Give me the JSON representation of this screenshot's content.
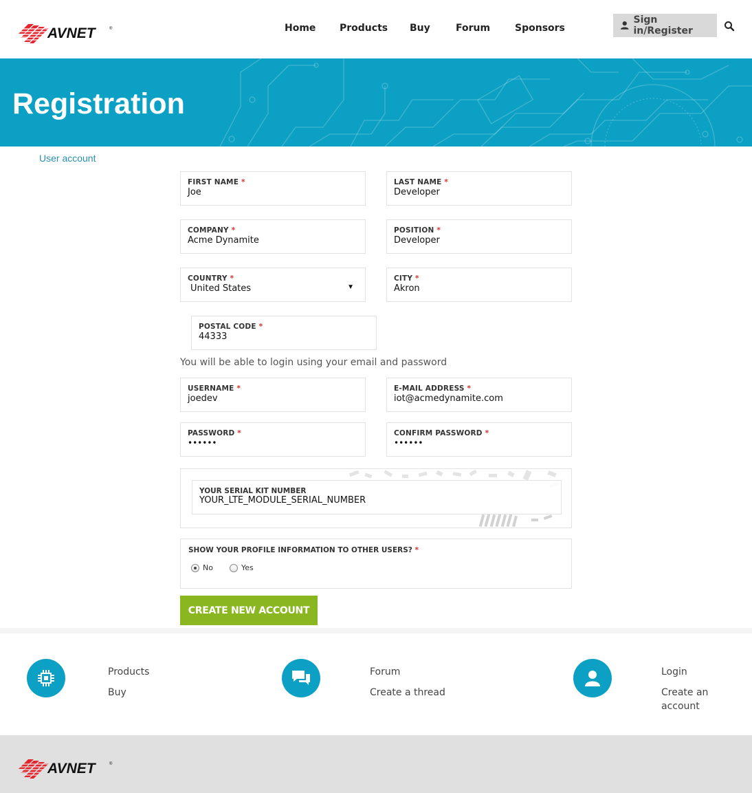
{
  "header": {
    "logo_text": "AVNET",
    "nav": [
      {
        "label": "Home"
      },
      {
        "label": "Products"
      },
      {
        "label": "Buy"
      },
      {
        "label": "Forum"
      },
      {
        "label": "Sponsors"
      }
    ],
    "signin_label": "Sign in/Register"
  },
  "banner": {
    "title": "Registration"
  },
  "breadcrumb": "User account",
  "form": {
    "first_name": {
      "label": "FIRST NAME",
      "value": "Joe"
    },
    "last_name": {
      "label": "LAST NAME",
      "value": "Developer"
    },
    "company": {
      "label": "COMPANY",
      "value": "Acme Dynamite"
    },
    "position": {
      "label": "POSITION",
      "value": "Developer"
    },
    "country": {
      "label": "COUNTRY",
      "value": "United States"
    },
    "city": {
      "label": "CITY",
      "value": "Akron"
    },
    "postal_code": {
      "label": "POSTAL CODE",
      "value": "44333"
    },
    "login_note": "You will be able to login using your email and password",
    "username": {
      "label": "USERNAME",
      "value": "joedev"
    },
    "email": {
      "label": "E-MAIL ADDRESS",
      "value": "iot@acmedynamite.com"
    },
    "password": {
      "label": "PASSWORD",
      "value": "••••••"
    },
    "confirm_password": {
      "label": "CONFIRM PASSWORD",
      "value": "••••••"
    },
    "serial_kit": {
      "label": "YOUR SERIAL KIT NUMBER",
      "value": "YOUR_LTE_MODULE_SERIAL_NUMBER"
    },
    "show_profile": {
      "label": "SHOW YOUR PROFILE INFORMATION TO OTHER USERS?",
      "options": [
        {
          "label": "No",
          "selected": true
        },
        {
          "label": "Yes",
          "selected": false
        }
      ]
    },
    "required_mark": "*",
    "submit_label": "CREATE NEW ACCOUNT"
  },
  "footer": {
    "columns": [
      {
        "icon": "chip-icon",
        "links": [
          "Products",
          "Buy"
        ]
      },
      {
        "icon": "chat-bubbles-icon",
        "links": [
          "Forum",
          "Create a thread"
        ]
      },
      {
        "icon": "user-icon",
        "links": [
          "Login",
          "Create an account"
        ]
      }
    ],
    "logo_text": "AVNET"
  },
  "colors": {
    "banner": "#0ca0c4",
    "button": "#8ab71f",
    "required": "#d9312d",
    "link": "#2a8fae",
    "logo_red": "#e4242c"
  }
}
